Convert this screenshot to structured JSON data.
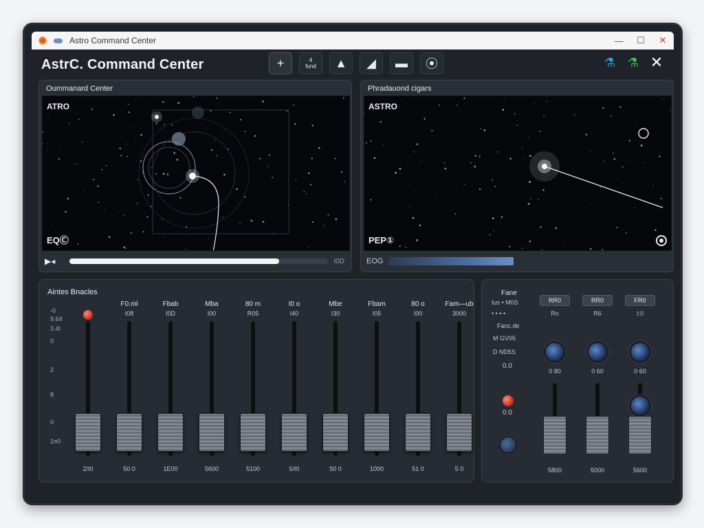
{
  "window": {
    "title": "Astro Command Center"
  },
  "header": {
    "app_title": "AstrC. Command Center",
    "toolbar": [
      {
        "name": "add-tool",
        "glyph": "+"
      },
      {
        "name": "grid-tool",
        "glyph": "4\nfund"
      },
      {
        "name": "shape-tool",
        "glyph": "▲"
      },
      {
        "name": "corner-tool",
        "glyph": "◢"
      },
      {
        "name": "folder-tool",
        "glyph": "▬"
      },
      {
        "name": "pin-tool",
        "glyph": "⦿"
      }
    ],
    "right_icons": [
      {
        "name": "flask-blue-icon",
        "glyph": "ठ",
        "color": "#29a3e0"
      },
      {
        "name": "flask-green-icon",
        "glyph": "ठ",
        "color": "#39c24a"
      },
      {
        "name": "close-icon",
        "glyph": "✕",
        "color": "#ffffff"
      }
    ]
  },
  "viewer_left": {
    "title": "Oummanard Center",
    "corner_label": "ATRO",
    "bottom_label": "EQⒸ",
    "progress_end": "I0D",
    "progress": 0.81
  },
  "viewer_right": {
    "title": "Phradauond cigars",
    "corner_label": "ASTRO",
    "bottom_label": "PEP①",
    "eq_label": "EOG"
  },
  "mixer": {
    "title": "Aintes Bnacles",
    "scale": [
      "-0",
      "9.64",
      "3.4I",
      "0",
      "2",
      "8",
      "0",
      "1¤0"
    ],
    "channels": [
      {
        "name": "",
        "value": "",
        "foot": "2/I0",
        "level": 0.04,
        "has_red": true
      },
      {
        "name": "F0.ml",
        "value": "I08",
        "foot": "50 0",
        "level": 0.04
      },
      {
        "name": "Fbab",
        "value": "I0D",
        "foot": "1E00",
        "level": 0.04
      },
      {
        "name": "Mba",
        "value": "I00",
        "foot": "5600",
        "level": 0.04
      },
      {
        "name": "80 m",
        "value": "R05",
        "foot": "5100",
        "level": 0.04
      },
      {
        "name": "I0 o",
        "value": "I40",
        "foot": "5/I0",
        "level": 0.04
      },
      {
        "name": "Mbe",
        "value": "I30",
        "foot": "50 0",
        "level": 0.04
      },
      {
        "name": "Fbam",
        "value": "I05",
        "foot": "1000",
        "level": 0.04
      },
      {
        "name": "80 o",
        "value": "I00",
        "foot": "51 0",
        "level": 0.04
      },
      {
        "name": "Fam—ub",
        "value": "3000",
        "foot": "5 0",
        "level": 0.04
      }
    ]
  },
  "fx": {
    "heading": "Fane",
    "labels": [
      "Ius • M0S",
      "• • • •",
      "Fanc.de",
      "M   GV05",
      "D   ND5S"
    ],
    "readouts": [
      "0.0",
      "0.0"
    ],
    "buttons": [
      {
        "label": "RR0",
        "sub": "Ro"
      },
      {
        "label": "RR0",
        "sub": "R6"
      },
      {
        "label": "FR0",
        "sub": "I:0"
      }
    ],
    "knob_values": [
      "0 80",
      "0 60",
      "0 60"
    ],
    "foot": [
      "5800",
      "5000",
      "5600"
    ],
    "fader_levels": [
      0.04,
      0.04,
      0.04
    ]
  }
}
